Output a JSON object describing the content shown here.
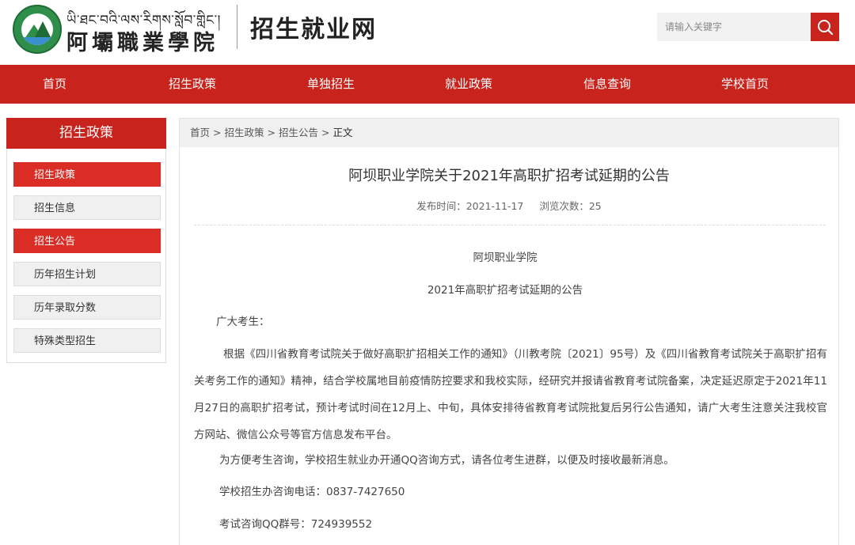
{
  "header": {
    "logo_tibetan": "ཡི་ཐང་བའི་ལས་རིགས་སློབ་གླིང་།",
    "logo_chinese": "阿壩職業學院",
    "site_title": "招生就业网",
    "search_placeholder": "请输入关键字"
  },
  "nav": {
    "items": [
      "首页",
      "招生政策",
      "单独招生",
      "就业政策",
      "信息查询",
      "学校首页"
    ]
  },
  "sidebar": {
    "title": "招生政策",
    "items": [
      {
        "label": "招生政策",
        "active": true
      },
      {
        "label": "招生信息",
        "active": false
      },
      {
        "label": "招生公告",
        "active": true
      },
      {
        "label": "历年招生计划",
        "active": false
      },
      {
        "label": "历年录取分数",
        "active": false
      },
      {
        "label": "特殊类型招生",
        "active": false
      }
    ]
  },
  "breadcrumb": {
    "items": [
      "首页",
      "招生政策",
      "招生公告",
      "正文"
    ],
    "separator": ">"
  },
  "article": {
    "title": "阿坝职业学院关于2021年高职扩招考试延期的公告",
    "publish_time": "发布时间：2021-11-17",
    "views": "浏览次数：25",
    "org": "阿坝职业学院",
    "subtitle": "2021年高职扩招考试延期的公告",
    "greeting": "广大考生：",
    "body": "根据《四川省教育考试院关于做好高职扩招相关工作的通知》（川教考院〔2021〕95号）及《四川省教育考试院关于高职扩招有关考务工作的通知》精神，结合学校属地目前疫情防控要求和我校实际，经研究并报请省教育考试院备案，决定延迟原定于2021年11月27日的高职扩招考试，预计考试时间在12月上、中旬，具体安排待省教育考试院批复后另行公告通知，请广大考生注意关注我校官方网站、微信公众号等官方信息发布平台。",
    "qq_note": "为方便考生咨询，学校招生就业办开通QQ咨询方式，请各位考生进群，以便及时接收最新消息。",
    "phone": "学校招生办咨询电话：0837-7427650",
    "qq_group": "考试咨询QQ群号：724939552"
  },
  "colors": {
    "brand_red": "#c8231c",
    "sidebar_active": "#d92d26"
  }
}
